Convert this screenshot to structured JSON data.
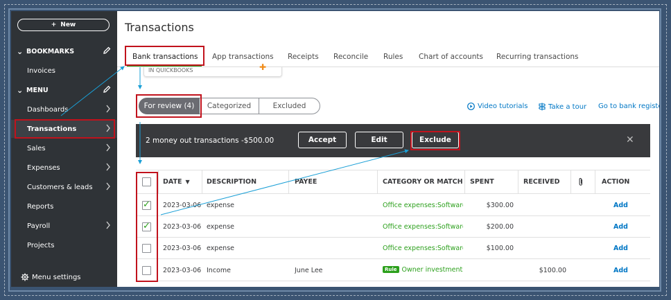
{
  "sidebar": {
    "new_label": "New",
    "bookmarks_label": "BOOKMARKS",
    "menu_label": "MENU",
    "items": [
      {
        "label": "Invoices"
      },
      {
        "label": "Dashboards"
      },
      {
        "label": "Transactions"
      },
      {
        "label": "Sales"
      },
      {
        "label": "Expenses"
      },
      {
        "label": "Customers & leads"
      },
      {
        "label": "Reports"
      },
      {
        "label": "Payroll"
      },
      {
        "label": "Projects"
      }
    ],
    "menu_settings_label": "Menu settings"
  },
  "main": {
    "title": "Transactions",
    "tabs": [
      {
        "label": "Bank transactions"
      },
      {
        "label": "App transactions"
      },
      {
        "label": "Receipts"
      },
      {
        "label": "Reconcile"
      },
      {
        "label": "Rules"
      },
      {
        "label": "Chart of accounts"
      },
      {
        "label": "Recurring transactions"
      }
    ],
    "card_label": "IN QUICKBOOKS",
    "segments": [
      {
        "label": "For review (4)"
      },
      {
        "label": "Categorized"
      },
      {
        "label": "Excluded"
      }
    ],
    "links": {
      "video": "Video tutorials",
      "tour": "Take a tour",
      "register": "Go to bank register"
    },
    "batch": {
      "message": "2 money out transactions -$500.00",
      "accept": "Accept",
      "edit": "Edit",
      "exclude": "Exclude"
    },
    "table": {
      "headers": {
        "date": "DATE",
        "description": "DESCRIPTION",
        "payee": "PAYEE",
        "category": "CATEGORY OR MATCH",
        "spent": "SPENT",
        "received": "RECEIVED",
        "action": "ACTION"
      },
      "rule_badge": "Rule",
      "rows": [
        {
          "checked": true,
          "date": "2023-03-06",
          "description": "expense",
          "payee": "",
          "category": "Office expenses:Software &",
          "rule": false,
          "spent": "$300.00",
          "received": "",
          "action": "Add"
        },
        {
          "checked": true,
          "date": "2023-03-06",
          "description": "expense",
          "payee": "",
          "category": "Office expenses:Software &",
          "rule": false,
          "spent": "$200.00",
          "received": "",
          "action": "Add"
        },
        {
          "checked": false,
          "date": "2023-03-06",
          "description": "expense",
          "payee": "",
          "category": "Office expenses:Software &",
          "rule": false,
          "spent": "$100.00",
          "received": "",
          "action": "Add"
        },
        {
          "checked": false,
          "date": "2023-03-06",
          "description": "Income",
          "payee": "June Lee",
          "category": "Owner investments",
          "rule": true,
          "spent": "",
          "received": "$100.00",
          "action": "Add"
        }
      ]
    }
  },
  "colors": {
    "accent_green": "#2ca01c",
    "link_blue": "#0077c5",
    "highlight_red": "#c1121c",
    "sidebar_bg": "#2f3337",
    "annotation_arrow": "#1a9fd6"
  }
}
